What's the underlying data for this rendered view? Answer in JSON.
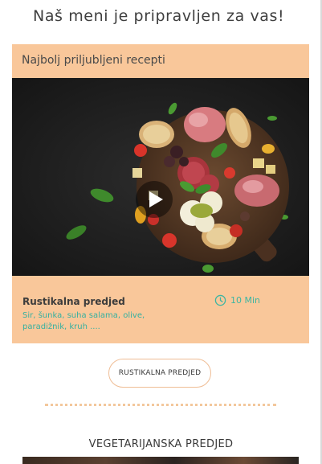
{
  "page": {
    "title": "Naš meni je pripravljen za vas!"
  },
  "featured": {
    "header": "Najbolj priljubljeni recepti",
    "recipe": {
      "title": "Rustikalna predjed",
      "time": "10 Min",
      "ingredients_line1": "Sir, šunka, suha salama, olive,",
      "ingredients_line2": "paradižnik, kruh ...."
    },
    "button_label": "RUSTIKALNA PREDJED"
  },
  "next_section": {
    "title": "VEGETARIJANSKA PREDJED"
  },
  "colors": {
    "card_background": "#f9c79a",
    "accent_teal": "#3cb5a2",
    "divider": "#f3c79c"
  },
  "icons": {
    "play": "play-icon",
    "clock": "clock-icon"
  }
}
